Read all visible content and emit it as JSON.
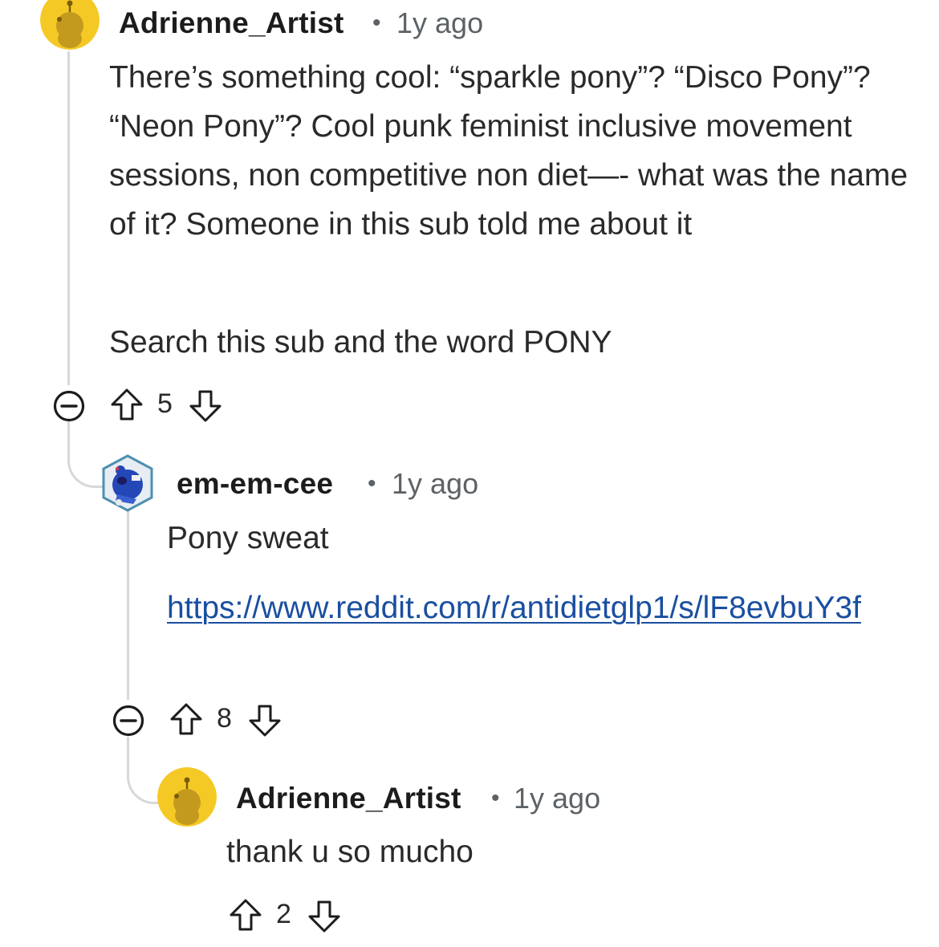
{
  "comments": [
    {
      "author": "Adrienne_Artist",
      "separator": "•",
      "time": "1y ago",
      "paragraphs": [
        "There’s something cool: “sparkle pony”? “Disco Pony”? “Neon Pony”? Cool punk feminist inclusive movement sessions, non competitive non diet—- what was the name of it? Someone in this sub told me about it",
        "Search this sub and the word PONY"
      ],
      "score": "5",
      "avatar_icon": "snoo-avatar-icon",
      "avatar_color": "#f5c925"
    },
    {
      "author": "em-em-cee",
      "separator": "•",
      "time": "1y ago",
      "paragraphs": [
        "Pony sweat"
      ],
      "link": "https://www.reddit.com/r/antidietglp1/s/lF8evbuY3f",
      "score": "8",
      "avatar_icon": "custom-avatar-icon"
    },
    {
      "author": "Adrienne_Artist",
      "separator": "•",
      "time": "1y ago",
      "paragraphs": [
        "thank u so mucho"
      ],
      "score": "2",
      "avatar_icon": "snoo-avatar-icon",
      "avatar_color": "#f5c925"
    }
  ],
  "colors": {
    "thread_line": "#d6d8da",
    "link": "#1a4fa0",
    "meta_text": "#5c6266"
  }
}
